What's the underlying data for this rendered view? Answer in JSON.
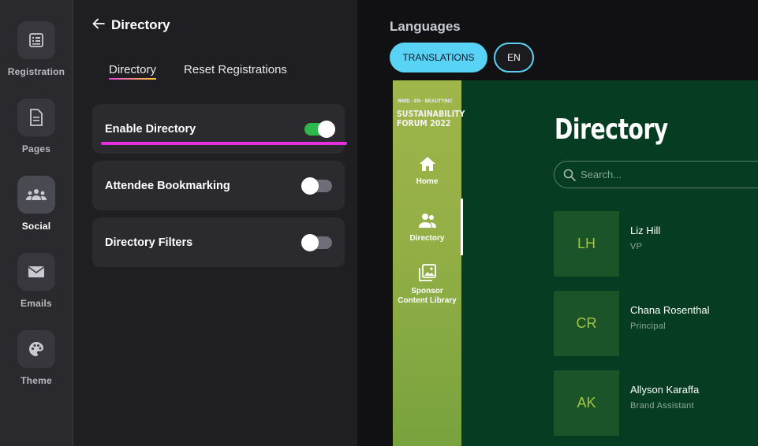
{
  "rail": {
    "items": [
      {
        "label": "Registration",
        "icon": "registration-icon"
      },
      {
        "label": "Pages",
        "icon": "pages-icon"
      },
      {
        "label": "Social",
        "icon": "social-icon",
        "active": true
      },
      {
        "label": "Emails",
        "icon": "email-icon"
      },
      {
        "label": "Theme",
        "icon": "palette-icon"
      }
    ]
  },
  "panel": {
    "back_title": "Directory",
    "tabs": [
      {
        "label": "Directory",
        "active": true
      },
      {
        "label": "Reset Registrations"
      }
    ],
    "settings": [
      {
        "label": "Enable Directory",
        "enabled": true
      },
      {
        "label": "Attendee Bookmarking",
        "enabled": false
      },
      {
        "label": "Directory Filters",
        "enabled": false
      }
    ]
  },
  "preview": {
    "languages_title": "Languages",
    "translations_label": "TRANSLATIONS",
    "lang_label": "EN",
    "mock": {
      "logo_small": "WWD · EN · BEAUTYINC",
      "logo_big": "SUSTAINABILITY FORUM 2022",
      "nav": [
        {
          "label": "Home",
          "icon": "home-icon"
        },
        {
          "label": "Directory",
          "icon": "people-icon"
        },
        {
          "label": "Sponsor Content Library",
          "icon": "gallery-icon"
        }
      ],
      "title": "Directory",
      "search_placeholder": "Search...",
      "people": [
        {
          "initials": "LH",
          "name": "Liz Hill",
          "role": "VP"
        },
        {
          "initials": "CR",
          "name": "Chana Rosenthal",
          "role": "Principal"
        },
        {
          "initials": "AK",
          "name": "Allyson Karaffa",
          "role": "Brand Assistant"
        }
      ]
    }
  },
  "colors": {
    "accent_cyan": "#58d2f5",
    "toggle_on": "#2db84b",
    "highlight": "#e52ee0",
    "mock_bg": "#063d22",
    "avatar_text": "#a5c441"
  }
}
